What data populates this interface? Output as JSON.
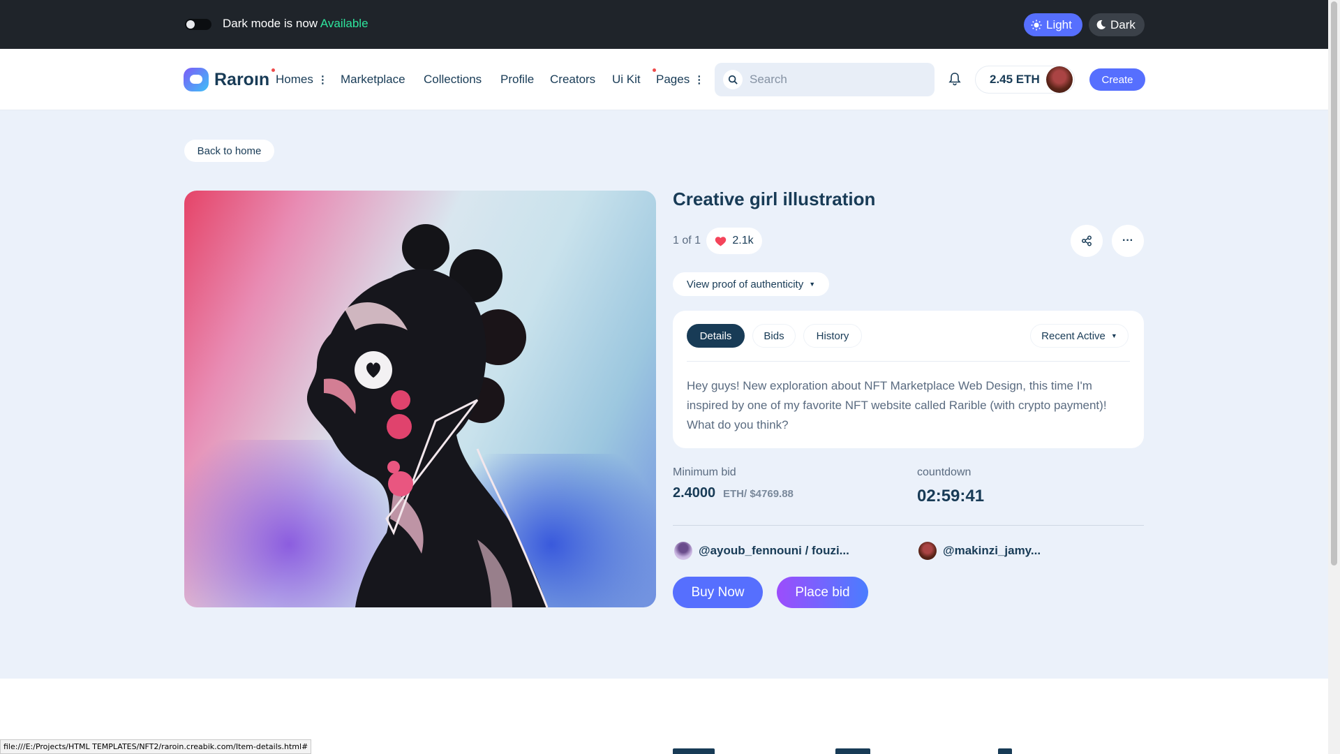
{
  "topbar": {
    "message": "Dark mode is now",
    "highlight": "Available",
    "light_label": "Light",
    "dark_label": "Dark"
  },
  "header": {
    "logo": "Raroın",
    "nav": [
      "Homes",
      "Marketplace",
      "Collections",
      "Profile",
      "Creators",
      "Ui Kit",
      "Pages"
    ],
    "search_placeholder": "Search",
    "wallet_balance": "2.45 ETH",
    "create_label": "Create"
  },
  "item": {
    "back_label": "Back to home",
    "title": "Creative girl illustration",
    "edition": "1 of 1",
    "likes": "2.1k",
    "proof_label": "View proof of authenticity",
    "tabs": [
      "Details",
      "Bids",
      "History"
    ],
    "filter_label": "Recent Active",
    "description": "Hey guys! New exploration about NFT Marketplace Web Design, this time I'm inspired by one of my favorite NFT website called Rarible (with crypto payment)! What do you think?",
    "min_bid_label": "Minimum bid",
    "min_bid_value": "2.4000",
    "min_bid_sub": "ETH/ $4769.88",
    "countdown_label": "countdown",
    "countdown_value": "02:59:41",
    "owner": "@ayoub_fennouni / fouzi...",
    "creator": "@makinzi_jamy...",
    "buy_label": "Buy Now",
    "bid_label": "Place bid"
  },
  "statusbar": {
    "url": "file:///E:/Projects/HTML TEMPLATES/NFT2/raroin.creabik.com/Item-details.html#"
  },
  "colors": {
    "accent": "#566ffe",
    "topbar": "#1f242a",
    "available": "#2ee59d",
    "heading": "#183b56",
    "hero_bg": "#ebf1fa"
  }
}
